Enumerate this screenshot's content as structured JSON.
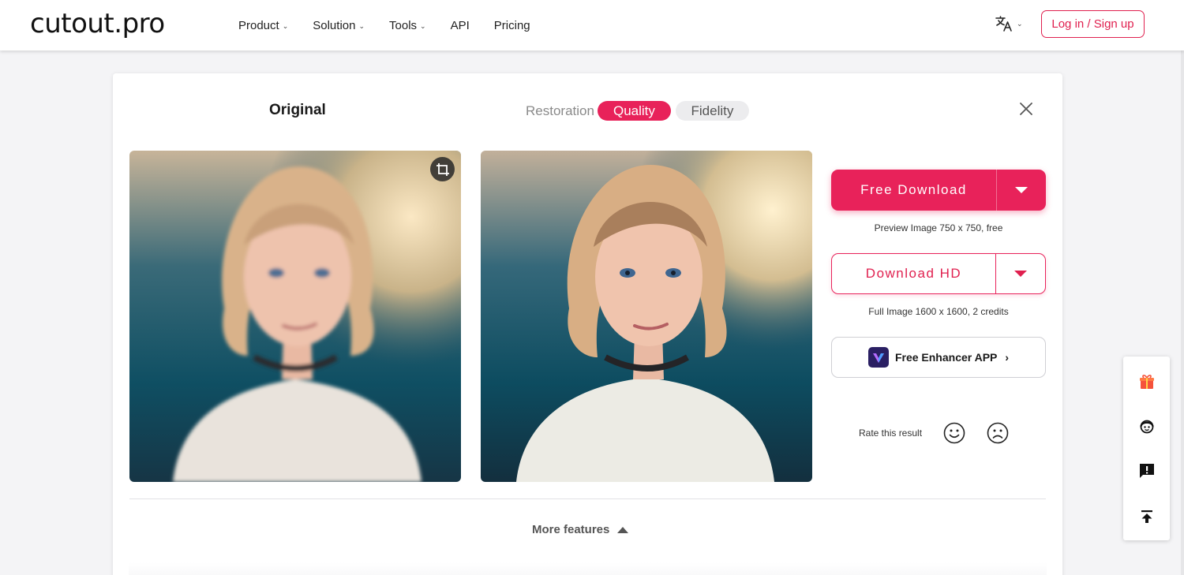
{
  "header": {
    "logo": "cutout.pro",
    "nav": [
      {
        "label": "Product",
        "has_menu": true
      },
      {
        "label": "Solution",
        "has_menu": true
      },
      {
        "label": "Tools",
        "has_menu": true
      },
      {
        "label": "API",
        "has_menu": false
      },
      {
        "label": "Pricing",
        "has_menu": false
      }
    ],
    "language_icon": "translate-icon",
    "login_label": "Log in / Sign up"
  },
  "compare": {
    "original_title": "Original",
    "mode_label": "Restoration",
    "modes": [
      "Quality",
      "Fidelity"
    ],
    "active_mode": "Quality"
  },
  "actions": {
    "free_download_label": "Free Download",
    "free_download_note": "Preview Image 750 x 750, free",
    "download_hd_label": "Download HD",
    "download_hd_note": "Full Image 1600 x 1600, 2 credits",
    "app_label": "Free Enhancer APP",
    "rate_label": "Rate this result"
  },
  "more_features_label": "More features",
  "colors": {
    "accent": "#e8225a",
    "accent_text": "#e0204f"
  },
  "float_toolbar": [
    "gift-icon",
    "support-agent-icon",
    "feedback-icon",
    "back-to-top-icon"
  ]
}
